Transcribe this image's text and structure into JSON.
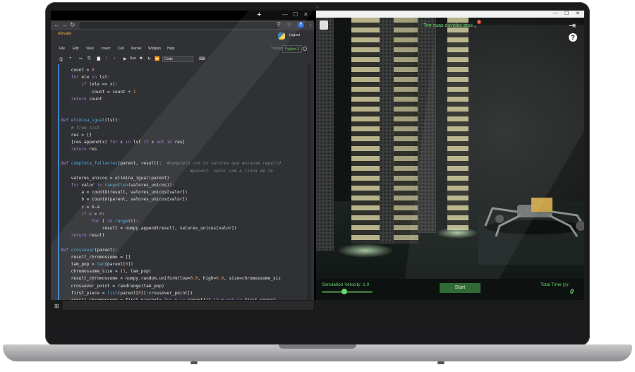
{
  "browser": {
    "new_tab": "+",
    "win_min": "—",
    "win_max": "☐",
    "win_close": "✕",
    "nav_back": "←",
    "nav_fwd": "→",
    "nav_reload": "↻",
    "profile_initial": "E"
  },
  "jupyter": {
    "notebook_name": "elevate",
    "logout": "Logout",
    "menu": [
      "File",
      "Edit",
      "View",
      "Insert",
      "Cell",
      "Kernel",
      "Widgets",
      "Help"
    ],
    "trusted": "Trusted",
    "kernel": "Python 3",
    "run": "Run",
    "cell_type": "Code"
  },
  "code_lines": [
    [
      [
        "    count = ",
        ""
      ],
      [
        "0",
        "num"
      ]
    ],
    [
      [
        "    ",
        ""
      ],
      [
        "for",
        "kw"
      ],
      [
        " ele ",
        ""
      ],
      [
        "in",
        "kw"
      ],
      [
        " lst:",
        ""
      ]
    ],
    [
      [
        "        ",
        ""
      ],
      [
        "if",
        "kw"
      ],
      [
        " (ele == x):",
        ""
      ]
    ],
    [
      [
        "            count = count + ",
        ""
      ],
      [
        "1",
        "num"
      ]
    ],
    [
      [
        "    ",
        ""
      ],
      [
        "return",
        "kw"
      ],
      [
        " count",
        ""
      ]
    ],
    [
      [
        "",
        ""
      ]
    ],
    [
      [
        "",
        ""
      ]
    ],
    [
      [
        "",
        ""
      ],
      [
        "def",
        "kw"
      ],
      [
        " ",
        ""
      ],
      [
        "elimina_igual",
        "fn"
      ],
      [
        "(lst):",
        ""
      ]
    ],
    [
      [
        "    ",
        ""
      ],
      [
        "# from list",
        "cm"
      ]
    ],
    [
      [
        "    res = []",
        ""
      ]
    ],
    [
      [
        "    [res.append(x) ",
        ""
      ],
      [
        "for",
        "kw"
      ],
      [
        " x ",
        ""
      ],
      [
        "in",
        "kw"
      ],
      [
        " lst ",
        ""
      ],
      [
        "if",
        "kw"
      ],
      [
        " x ",
        ""
      ],
      [
        "not in",
        "kw"
      ],
      [
        " res]",
        ""
      ]
    ],
    [
      [
        "    ",
        ""
      ],
      [
        "return",
        "kw"
      ],
      [
        " res",
        ""
      ]
    ],
    [
      [
        "",
        ""
      ]
    ],
    [
      [
        "",
        ""
      ],
      [
        "def",
        "kw"
      ],
      [
        " ",
        ""
      ],
      [
        "completa_faltantes",
        "fn"
      ],
      [
        "(parent, result):  ",
        ""
      ],
      [
        "#completa com os valores que estavam repetid",
        "cm"
      ]
    ],
    [
      [
        "                                                  ",
        ""
      ],
      [
        "#parent: vetor com a linha de te",
        "cm"
      ]
    ],
    [
      [
        "    valores_unicos = elimina_igual(parent)",
        ""
      ]
    ],
    [
      [
        "    ",
        ""
      ],
      [
        "for",
        "kw"
      ],
      [
        " valor ",
        ""
      ],
      [
        "in",
        "kw"
      ],
      [
        " ",
        ""
      ],
      [
        "range",
        "fn"
      ],
      [
        "(",
        ""
      ],
      [
        "len",
        "fn"
      ],
      [
        "(valores_unicos)):",
        ""
      ]
    ],
    [
      [
        "        a = countX(result, valores_unicos[valor])",
        ""
      ]
    ],
    [
      [
        "        b = countX(parent, valores_unicos[valor])",
        ""
      ]
    ],
    [
      [
        "        c = b-a",
        ""
      ]
    ],
    [
      [
        "        ",
        ""
      ],
      [
        "if",
        "kw"
      ],
      [
        " c > ",
        ""
      ],
      [
        "0",
        "num"
      ],
      [
        ":",
        ""
      ]
    ],
    [
      [
        "            ",
        ""
      ],
      [
        "for",
        "kw"
      ],
      [
        " i ",
        ""
      ],
      [
        "in",
        "kw"
      ],
      [
        " ",
        ""
      ],
      [
        "range",
        "fn"
      ],
      [
        "(c):",
        ""
      ]
    ],
    [
      [
        "                result = numpy.append(result, valores_unicos[valor])",
        ""
      ]
    ],
    [
      [
        "    ",
        ""
      ],
      [
        "return",
        "kw"
      ],
      [
        " result",
        ""
      ]
    ],
    [
      [
        "",
        ""
      ]
    ],
    [
      [
        "",
        ""
      ],
      [
        "def",
        "kw"
      ],
      [
        " ",
        ""
      ],
      [
        "crossover",
        "fn"
      ],
      [
        "(parent):",
        ""
      ]
    ],
    [
      [
        "    result_chromossome = []",
        ""
      ]
    ],
    [
      [
        "    tam_pop = ",
        ""
      ],
      [
        "len",
        "fn"
      ],
      [
        "(parent[",
        ""
      ],
      [
        "0",
        "num"
      ],
      [
        "])",
        ""
      ]
    ],
    [
      [
        "    chromossome_size = (",
        ""
      ],
      [
        "1",
        "num"
      ],
      [
        ", tam_pop)",
        ""
      ]
    ],
    [
      [
        "    result_chromossome = numpy.random.uniform(low=",
        ""
      ],
      [
        "0.0",
        "num"
      ],
      [
        ", high=",
        ""
      ],
      [
        "0.0",
        "num"
      ],
      [
        ", size=chromossome_siz",
        ""
      ]
    ],
    [
      [
        "    crossover_point = randrange(tam_pop)",
        ""
      ]
    ],
    [
      [
        "    first_piece = ",
        ""
      ],
      [
        "list",
        "fn"
      ],
      [
        "(parent[",
        ""
      ],
      [
        "0",
        "num"
      ],
      [
        "][:crossover_point])",
        ""
      ]
    ],
    [
      [
        "    result_chromossome = first_piece+[x ",
        ""
      ],
      [
        "for",
        "kw"
      ],
      [
        " x ",
        ""
      ],
      [
        "in",
        "kw"
      ],
      [
        " parent[",
        ""
      ],
      [
        "1",
        "num"
      ],
      [
        "] ",
        ""
      ],
      [
        "if",
        "kw"
      ],
      [
        " x ",
        ""
      ],
      [
        "not in",
        "kw"
      ],
      [
        " first_piece]",
        ""
      ]
    ]
  ],
  "sim": {
    "tip_text": "Tire suas dúvidas aqui",
    "tip_badge": "1",
    "help": "?",
    "velocity_label": "Simulation Velocity: 1.0",
    "velocity_level": 0.45,
    "start": "Start",
    "total_time_label": "Total Time (s):",
    "total_time_value": "0",
    "accent": "#68d86a"
  }
}
